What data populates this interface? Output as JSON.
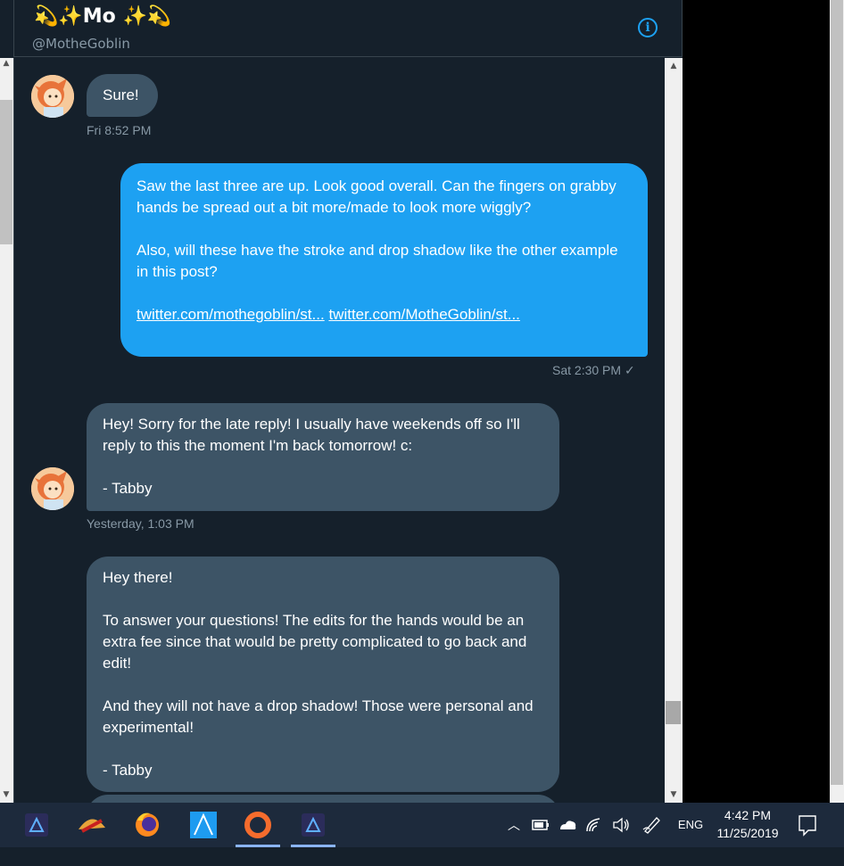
{
  "header": {
    "title": "💫✨Mo ✨💫",
    "handle": "@MotheGoblin",
    "info_label": "i"
  },
  "messages": [
    {
      "text": "Sure!",
      "time": "Fri 8:52 PM"
    },
    {
      "paragraphs": [
        "Saw the last three are up. Look good overall. Can the fingers on grabby hands be spread out a bit more/made to look more wiggly?",
        "Also, will these have the stroke and drop shadow like the other example in this post?"
      ],
      "links": [
        "twitter.com/mothegoblin/st...",
        "twitter.com/MotheGoblin/st..."
      ],
      "time": "Sat 2:30 PM",
      "status": "✓"
    },
    {
      "paragraphs": [
        "Hey! Sorry for the late reply! I usually have weekends off so I'll reply to this the moment I'm back tomorrow! c:",
        "- Tabby"
      ],
      "time": "Yesterday, 1:03 PM"
    },
    {
      "paragraphs": [
        "Hey there!",
        "To answer your questions! The edits for the hands would be an extra fee since that would be pretty complicated to go back and edit!",
        "And they will not have a drop shadow! Those were personal and experimental!",
        "- Tabby"
      ]
    }
  ],
  "taskbar": {
    "apps": [
      "affinity-photo",
      "affinity-app",
      "firefox",
      "affinity-designer",
      "origin",
      "affinity-photo-2"
    ],
    "language": "ENG",
    "time": "4:42 PM",
    "date": "11/25/2019"
  },
  "colors": {
    "accent": "#1da1f2",
    "bubble_received": "#3d5466",
    "background": "#15202b"
  }
}
